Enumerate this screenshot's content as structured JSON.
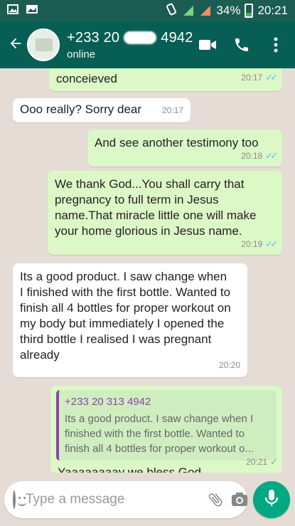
{
  "status_bar": {
    "battery": "34%",
    "time": "20:21"
  },
  "header": {
    "contact_prefix": "+233 20",
    "contact_suffix": "4942",
    "status": "online"
  },
  "messages": [
    {
      "direction": "out",
      "text": "conceieved",
      "time": "20:17",
      "status": "read"
    },
    {
      "direction": "in",
      "text": "Ooo really? Sorry dear",
      "time": "20:17"
    },
    {
      "direction": "out",
      "text": "And see another testimony too",
      "time": "20:18",
      "status": "read"
    },
    {
      "direction": "out",
      "text": "We thank God...You shall carry that pregnancy to full term in Jesus name.That miracle little one will make your home glorious in Jesus name.",
      "time": "20:19",
      "status": "read"
    },
    {
      "direction": "in",
      "text": "Its a good product. I saw change when I finished with the first bottle. Wanted to finish all 4 bottles for proper workout on my body but immediately I opened the third bottle I realised I was pregnant already",
      "time": "20:20"
    },
    {
      "direction": "out",
      "quote_author": "+233 20 313 4942",
      "quote_text": "Its a good product. I saw change when I finished with the first bottle. Wanted to finish all 4 bottles for proper workout o...",
      "text": "Yaaaaaaaay we bless God",
      "time": "20:21",
      "status": "sent"
    }
  ],
  "input": {
    "placeholder": "Type a message"
  },
  "icons": {
    "back": "arrow-left",
    "video": "video-camera",
    "call": "phone",
    "menu": "more-vertical",
    "emoji": "smiley",
    "attach": "paperclip",
    "camera": "camera",
    "mic": "microphone"
  },
  "colors": {
    "header": "#075e54",
    "outgoing_bubble": "#dcf8c6",
    "incoming_bubble": "#ffffff",
    "read_ticks": "#4fc3f7",
    "mic_button": "#00a884"
  }
}
